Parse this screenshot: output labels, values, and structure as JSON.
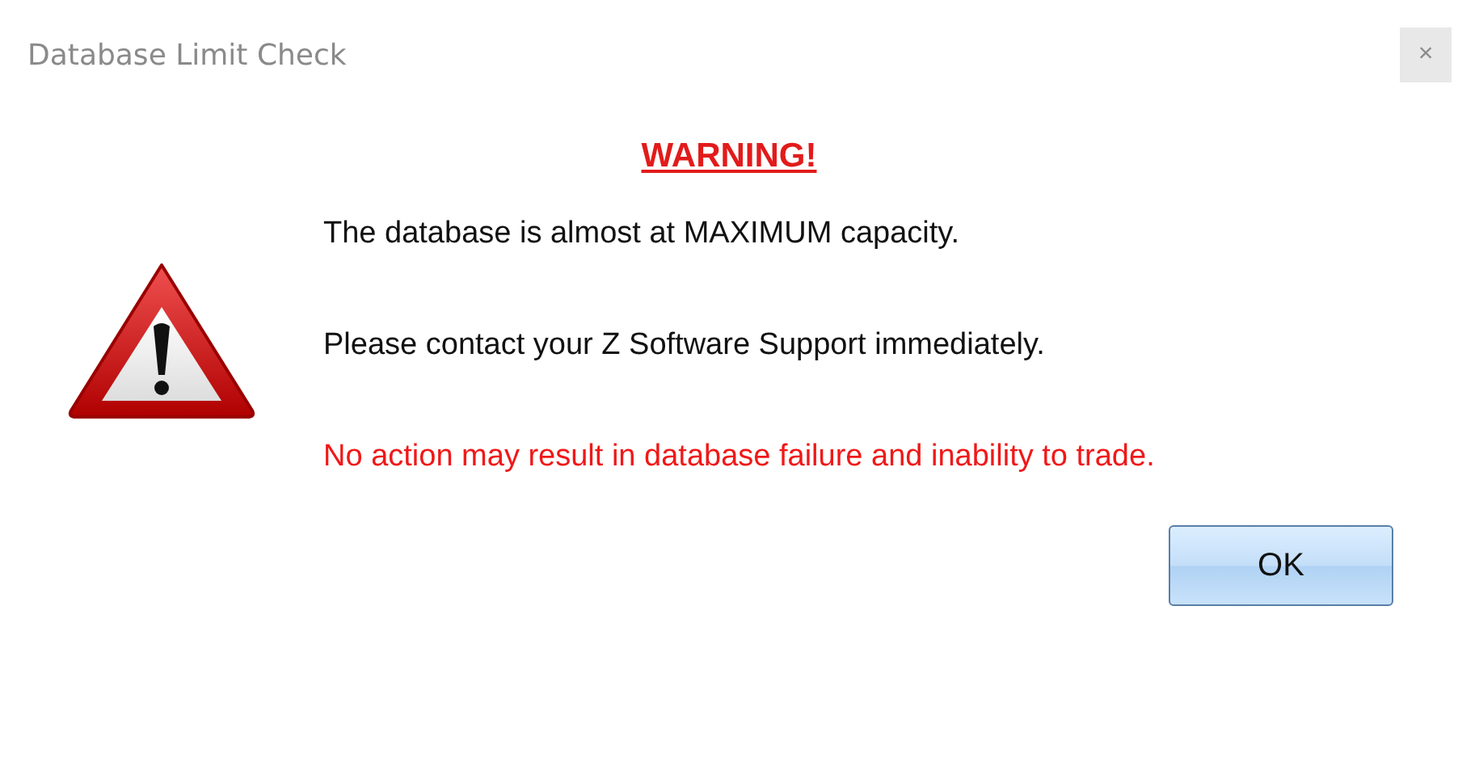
{
  "window": {
    "title": "Database Limit Check",
    "close": "×"
  },
  "heading": "WARNING!",
  "messages": [
    {
      "text": "The database is almost at MAXIMUM capacity.",
      "kind": "normal"
    },
    {
      "text": "Please contact your Z Software Support immediately.",
      "kind": "normal"
    },
    {
      "text": "No action may result in database failure and inability to trade.",
      "kind": "alert"
    }
  ],
  "buttons": [
    {
      "label": "OK"
    }
  ]
}
